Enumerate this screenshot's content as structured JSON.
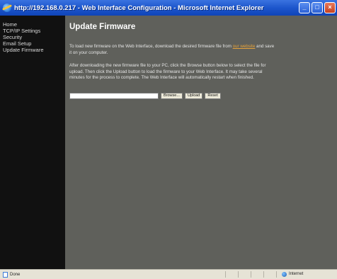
{
  "window": {
    "title": "http://192.168.0.217 - Web Interface Configuration - Microsoft Internet Explorer"
  },
  "sidebar": {
    "items": [
      {
        "label": "Home"
      },
      {
        "label": "TCP/IP Settings"
      },
      {
        "label": "Security"
      },
      {
        "label": "Email Setup"
      },
      {
        "label": "Update Firmware"
      }
    ]
  },
  "main": {
    "title": "Update Firmware",
    "para1_before": "To load new firmware on the Web Interface, download the desired firmware file from ",
    "para1_link": "our website",
    "para1_after": " and save it on your computer.",
    "para2": "After downloading the new firmware file to your PC, click the Browse button below to select the file for upload. Then click the Upload button to load the firmware to your Web Interface. It may take several minutes for the process to complete. The Web Interface will automatically restart when finished."
  },
  "form": {
    "file_value": "",
    "browse_label": "Browse...",
    "upload_label": "Upload",
    "reset_label": "Reset"
  },
  "statusbar": {
    "status_text": "Done",
    "zone_text": "Internet"
  },
  "colors": {
    "sidebar_bg": "#111111",
    "main_bg": "#5f605b",
    "link": "#e6a23a",
    "titlebar": "#1d56cc"
  }
}
